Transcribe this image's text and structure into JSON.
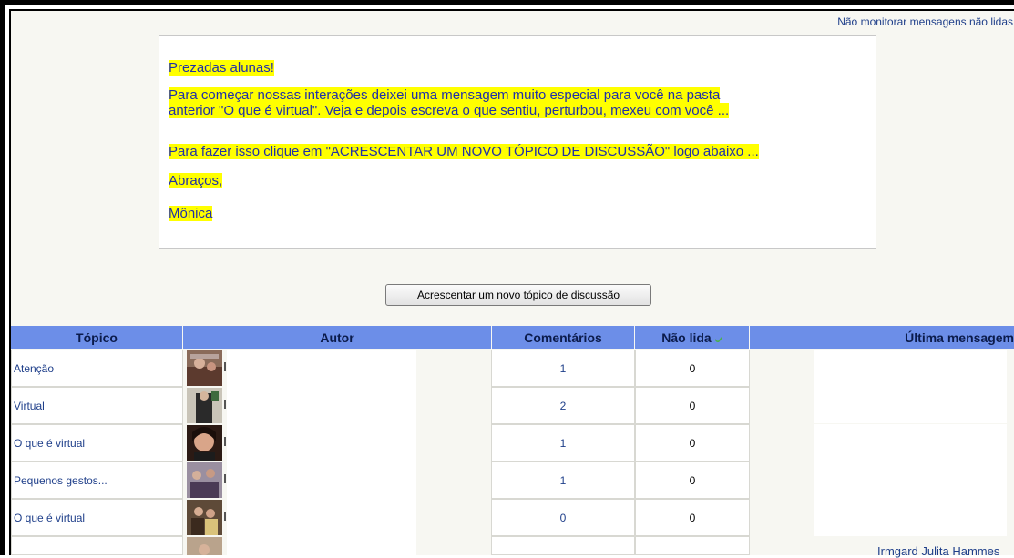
{
  "header": {
    "unread_link": "Não monitorar mensagens não lidas"
  },
  "message": {
    "greeting": "Prezadas alunas!",
    "para1_line1": "Para começar nossas interações deixei uma mensagem muito especial para você  na pasta",
    "para1_line2": "anterior \"O que é virtual\". Veja e depois escreva o que sentiu, perturbou, mexeu com você ...",
    "para2": " Para fazer isso clique em \"ACRESCENTAR UM NOVO TÓPICO DE DISCUSSÃO\" logo abaixo ...",
    "closing": "Abraços,",
    "signature": "Mônica"
  },
  "add_button_label": "Acrescentar um novo tópico de discussão",
  "table": {
    "columns": {
      "topic": "Tópico",
      "author": "Autor",
      "comments": "Comentários",
      "unread": "Não lida",
      "last": "Última mensagem"
    },
    "rows": [
      {
        "topic": "Atenção",
        "comments": "1",
        "unread": "0"
      },
      {
        "topic": "Virtual",
        "comments": "2",
        "unread": "0"
      },
      {
        "topic": "O que é virtual",
        "comments": "1",
        "unread": "0"
      },
      {
        "topic": "Pequenos gestos...",
        "comments": "1",
        "unread": "0"
      },
      {
        "topic": "O que é virtual",
        "comments": "0",
        "unread": "0"
      }
    ],
    "partial_last_author": "Irmgard Julita Hammes"
  },
  "colors": {
    "header_bg": "#6c8ee8",
    "highlight": "#ffff00",
    "link": "#1f3f8a"
  }
}
